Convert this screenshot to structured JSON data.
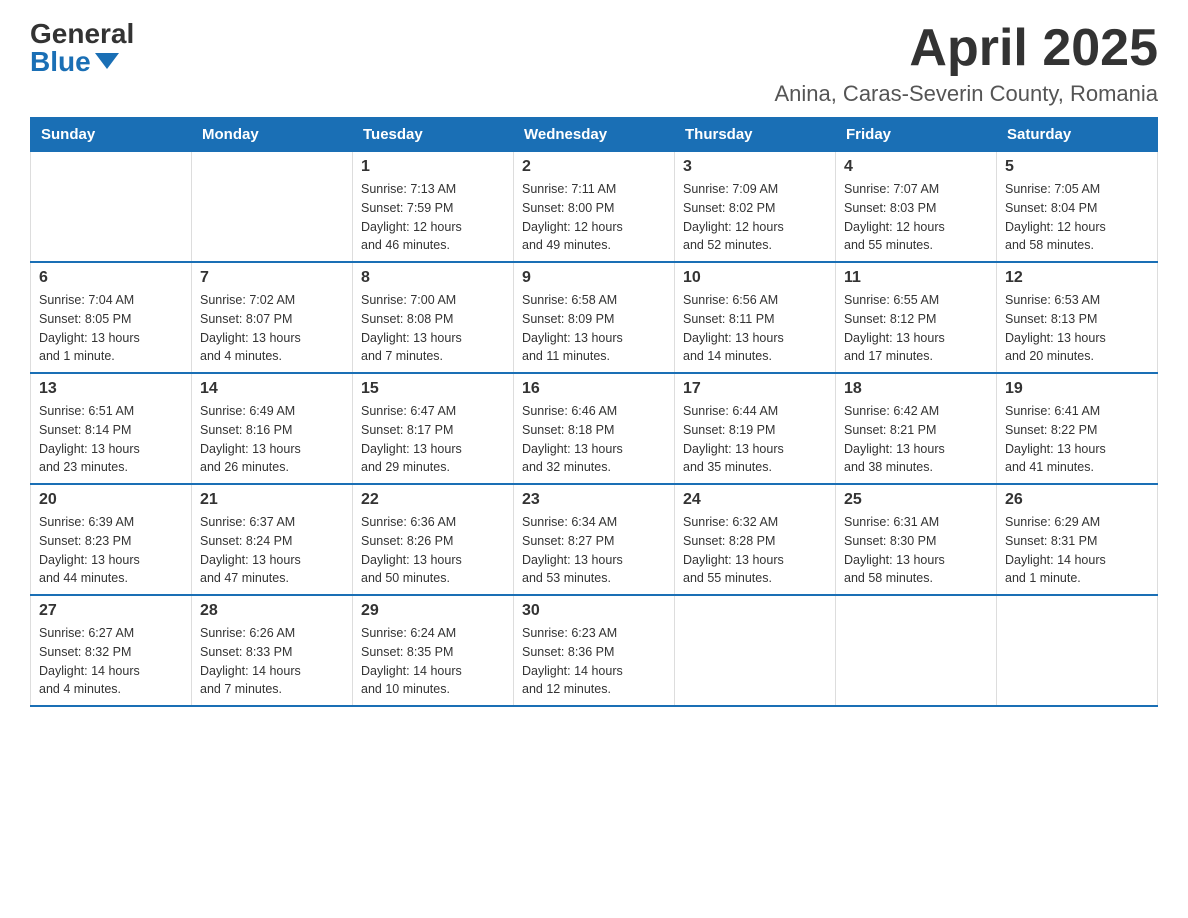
{
  "logo": {
    "general": "General",
    "blue": "Blue"
  },
  "title": "April 2025",
  "location": "Anina, Caras-Severin County, Romania",
  "days_of_week": [
    "Sunday",
    "Monday",
    "Tuesday",
    "Wednesday",
    "Thursday",
    "Friday",
    "Saturday"
  ],
  "weeks": [
    [
      {
        "day": "",
        "info": ""
      },
      {
        "day": "",
        "info": ""
      },
      {
        "day": "1",
        "info": "Sunrise: 7:13 AM\nSunset: 7:59 PM\nDaylight: 12 hours\nand 46 minutes."
      },
      {
        "day": "2",
        "info": "Sunrise: 7:11 AM\nSunset: 8:00 PM\nDaylight: 12 hours\nand 49 minutes."
      },
      {
        "day": "3",
        "info": "Sunrise: 7:09 AM\nSunset: 8:02 PM\nDaylight: 12 hours\nand 52 minutes."
      },
      {
        "day": "4",
        "info": "Sunrise: 7:07 AM\nSunset: 8:03 PM\nDaylight: 12 hours\nand 55 minutes."
      },
      {
        "day": "5",
        "info": "Sunrise: 7:05 AM\nSunset: 8:04 PM\nDaylight: 12 hours\nand 58 minutes."
      }
    ],
    [
      {
        "day": "6",
        "info": "Sunrise: 7:04 AM\nSunset: 8:05 PM\nDaylight: 13 hours\nand 1 minute."
      },
      {
        "day": "7",
        "info": "Sunrise: 7:02 AM\nSunset: 8:07 PM\nDaylight: 13 hours\nand 4 minutes."
      },
      {
        "day": "8",
        "info": "Sunrise: 7:00 AM\nSunset: 8:08 PM\nDaylight: 13 hours\nand 7 minutes."
      },
      {
        "day": "9",
        "info": "Sunrise: 6:58 AM\nSunset: 8:09 PM\nDaylight: 13 hours\nand 11 minutes."
      },
      {
        "day": "10",
        "info": "Sunrise: 6:56 AM\nSunset: 8:11 PM\nDaylight: 13 hours\nand 14 minutes."
      },
      {
        "day": "11",
        "info": "Sunrise: 6:55 AM\nSunset: 8:12 PM\nDaylight: 13 hours\nand 17 minutes."
      },
      {
        "day": "12",
        "info": "Sunrise: 6:53 AM\nSunset: 8:13 PM\nDaylight: 13 hours\nand 20 minutes."
      }
    ],
    [
      {
        "day": "13",
        "info": "Sunrise: 6:51 AM\nSunset: 8:14 PM\nDaylight: 13 hours\nand 23 minutes."
      },
      {
        "day": "14",
        "info": "Sunrise: 6:49 AM\nSunset: 8:16 PM\nDaylight: 13 hours\nand 26 minutes."
      },
      {
        "day": "15",
        "info": "Sunrise: 6:47 AM\nSunset: 8:17 PM\nDaylight: 13 hours\nand 29 minutes."
      },
      {
        "day": "16",
        "info": "Sunrise: 6:46 AM\nSunset: 8:18 PM\nDaylight: 13 hours\nand 32 minutes."
      },
      {
        "day": "17",
        "info": "Sunrise: 6:44 AM\nSunset: 8:19 PM\nDaylight: 13 hours\nand 35 minutes."
      },
      {
        "day": "18",
        "info": "Sunrise: 6:42 AM\nSunset: 8:21 PM\nDaylight: 13 hours\nand 38 minutes."
      },
      {
        "day": "19",
        "info": "Sunrise: 6:41 AM\nSunset: 8:22 PM\nDaylight: 13 hours\nand 41 minutes."
      }
    ],
    [
      {
        "day": "20",
        "info": "Sunrise: 6:39 AM\nSunset: 8:23 PM\nDaylight: 13 hours\nand 44 minutes."
      },
      {
        "day": "21",
        "info": "Sunrise: 6:37 AM\nSunset: 8:24 PM\nDaylight: 13 hours\nand 47 minutes."
      },
      {
        "day": "22",
        "info": "Sunrise: 6:36 AM\nSunset: 8:26 PM\nDaylight: 13 hours\nand 50 minutes."
      },
      {
        "day": "23",
        "info": "Sunrise: 6:34 AM\nSunset: 8:27 PM\nDaylight: 13 hours\nand 53 minutes."
      },
      {
        "day": "24",
        "info": "Sunrise: 6:32 AM\nSunset: 8:28 PM\nDaylight: 13 hours\nand 55 minutes."
      },
      {
        "day": "25",
        "info": "Sunrise: 6:31 AM\nSunset: 8:30 PM\nDaylight: 13 hours\nand 58 minutes."
      },
      {
        "day": "26",
        "info": "Sunrise: 6:29 AM\nSunset: 8:31 PM\nDaylight: 14 hours\nand 1 minute."
      }
    ],
    [
      {
        "day": "27",
        "info": "Sunrise: 6:27 AM\nSunset: 8:32 PM\nDaylight: 14 hours\nand 4 minutes."
      },
      {
        "day": "28",
        "info": "Sunrise: 6:26 AM\nSunset: 8:33 PM\nDaylight: 14 hours\nand 7 minutes."
      },
      {
        "day": "29",
        "info": "Sunrise: 6:24 AM\nSunset: 8:35 PM\nDaylight: 14 hours\nand 10 minutes."
      },
      {
        "day": "30",
        "info": "Sunrise: 6:23 AM\nSunset: 8:36 PM\nDaylight: 14 hours\nand 12 minutes."
      },
      {
        "day": "",
        "info": ""
      },
      {
        "day": "",
        "info": ""
      },
      {
        "day": "",
        "info": ""
      }
    ]
  ]
}
